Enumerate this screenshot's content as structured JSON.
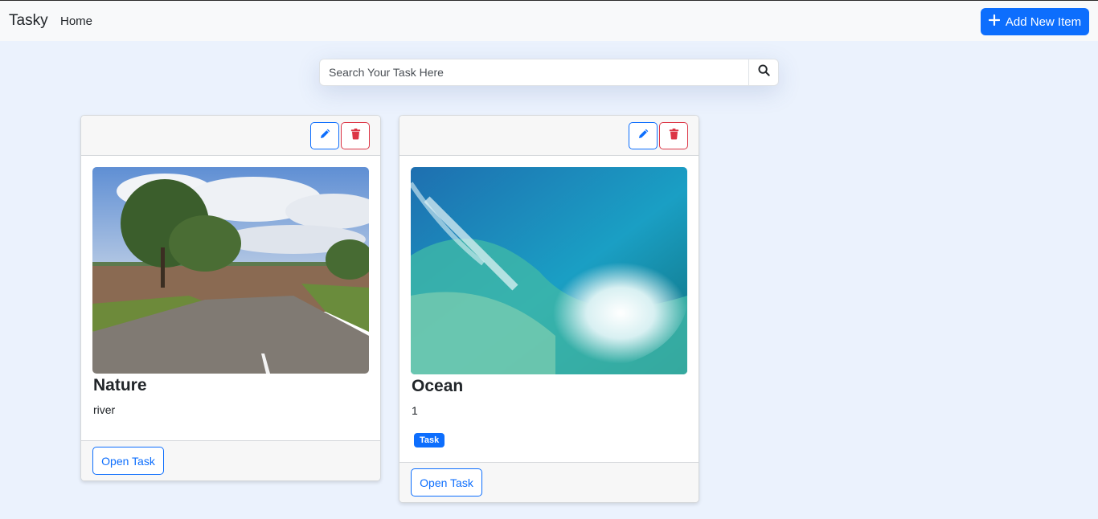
{
  "navbar": {
    "brand": "Tasky",
    "home_label": "Home",
    "add_button_label": "Add New Item"
  },
  "search": {
    "placeholder": "Search Your Task Here"
  },
  "cards": [
    {
      "title": "Nature",
      "description": "river",
      "image_alt": "Flooded road with trees",
      "open_label": "Open Task"
    },
    {
      "title": "Ocean",
      "description": "1",
      "badge": "Task",
      "image_alt": "Ocean wave barrel",
      "open_label": "Open Task"
    }
  ],
  "colors": {
    "primary": "#0d6efd",
    "danger": "#dc3545",
    "page_background": "#ebf2fd",
    "navbar_background": "#f8f9fa"
  },
  "icons": [
    "plus-icon",
    "search-icon",
    "pencil-icon",
    "trash-icon"
  ]
}
